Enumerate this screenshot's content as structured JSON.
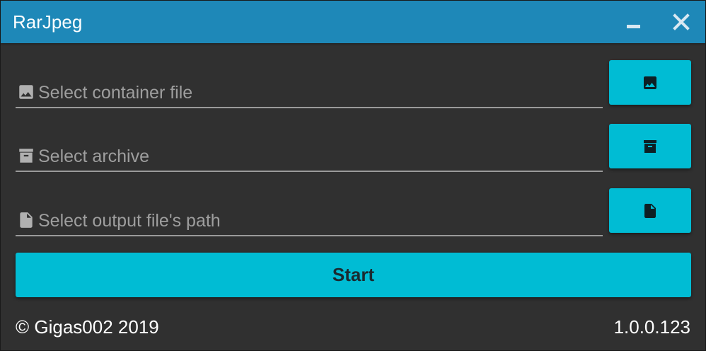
{
  "window": {
    "title": "RarJpeg"
  },
  "titlebar": {
    "minimize_icon": "minimize-icon",
    "close_icon": "close-icon"
  },
  "fields": {
    "container": {
      "placeholder": "Select container file",
      "value": "",
      "icon": "image-icon",
      "button_icon": "image-icon"
    },
    "archive": {
      "placeholder": "Select archive",
      "value": "",
      "icon": "archive-box-icon",
      "button_icon": "archive-box-icon"
    },
    "output": {
      "placeholder": "Select output file's path",
      "value": "",
      "icon": "file-icon",
      "button_icon": "file-icon"
    }
  },
  "actions": {
    "start_label": "Start"
  },
  "footer": {
    "copyright": "© Gigas002 2019",
    "version": "1.0.0.123"
  },
  "colors": {
    "titlebar": "#1e88b8",
    "background": "#303030",
    "accent": "#00bcd4",
    "text": "#ffffff",
    "placeholder": "#9e9e9e"
  }
}
